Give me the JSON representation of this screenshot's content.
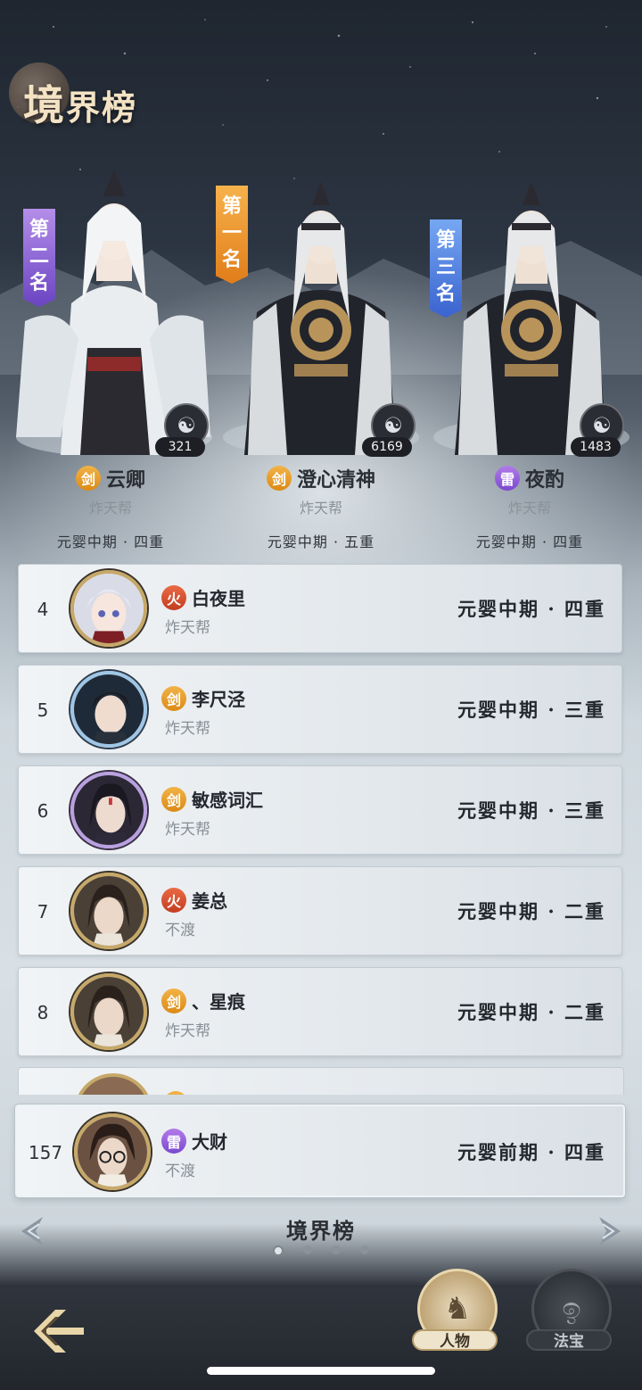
{
  "header": {
    "title_big": "境",
    "title_small": "界榜"
  },
  "podium": [
    {
      "place_label": [
        "第",
        "二",
        "名"
      ],
      "banner_color": "#8a5cd6",
      "name": "云卿",
      "element": "剑",
      "element_type": "sword",
      "guild": "炸天帮",
      "realm": "元婴中期 · 四重",
      "score": "321",
      "outfit": "white"
    },
    {
      "place_label": [
        "第",
        "一",
        "名"
      ],
      "banner_color": "#ef9a30",
      "name": "澄心清神",
      "element": "剑",
      "element_type": "sword",
      "guild": "炸天帮",
      "realm": "元婴中期 · 五重",
      "score": "6169",
      "outfit": "dark"
    },
    {
      "place_label": [
        "第",
        "三",
        "名"
      ],
      "banner_color": "#4b7fe0",
      "name": "夜酌",
      "element": "雷",
      "element_type": "thunder",
      "guild": "炸天帮",
      "realm": "元婴中期 · 四重",
      "score": "1483",
      "outfit": "dark"
    }
  ],
  "ranks": [
    {
      "rank": "4",
      "name": "白夜里",
      "element": "火",
      "element_type": "fire",
      "guild": "炸天帮",
      "realm": "元婴中期 · 四重"
    },
    {
      "rank": "5",
      "name": "李尺泾",
      "element": "剑",
      "element_type": "sword",
      "guild": "炸天帮",
      "realm": "元婴中期 · 三重"
    },
    {
      "rank": "6",
      "name": "敏感词汇",
      "element": "剑",
      "element_type": "sword",
      "guild": "炸天帮",
      "realm": "元婴中期 · 三重"
    },
    {
      "rank": "7",
      "name": "姜总",
      "element": "火",
      "element_type": "fire",
      "guild": "不渡",
      "realm": "元婴中期 · 二重"
    },
    {
      "rank": "8",
      "name": "、星痕",
      "element": "剑",
      "element_type": "sword",
      "guild": "炸天帮",
      "realm": "元婴中期 · 二重"
    }
  ],
  "self_rank": {
    "rank": "157",
    "name": "大财",
    "element": "雷",
    "element_type": "thunder",
    "guild": "不渡",
    "realm": "元婴前期 · 四重"
  },
  "pager": {
    "title": "境界榜",
    "page_count": 4,
    "active_index": 0
  },
  "nav": {
    "tab_person": "人物",
    "tab_treasure": "法宝",
    "active": "person"
  },
  "colors": {
    "sword": "#e69a2a",
    "fire": "#d6502e",
    "thunder": "#9560dc",
    "gold_frame": "#c6a868"
  }
}
